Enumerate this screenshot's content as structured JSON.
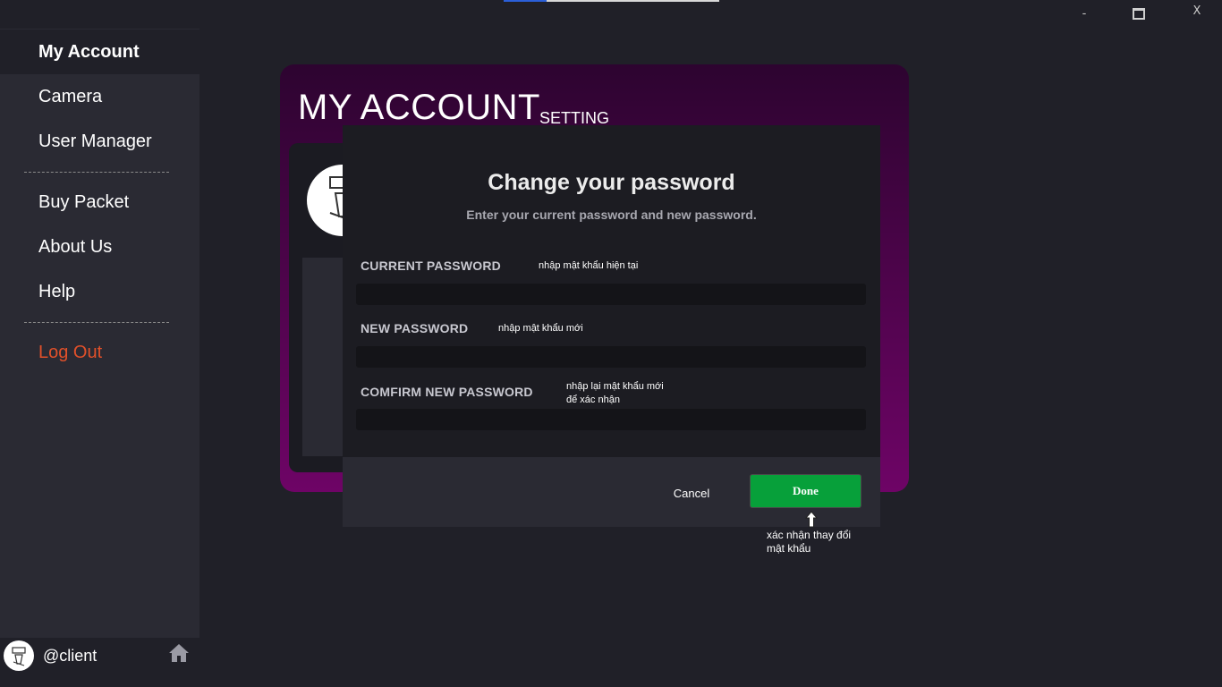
{
  "titlebar": {
    "minimize_glyph": "-",
    "close_glyph": "X",
    "progress": 0.2
  },
  "sidebar": {
    "items": [
      {
        "label": "My Account"
      },
      {
        "label": "Camera"
      },
      {
        "label": "User Manager"
      },
      {
        "label": "Buy Packet"
      },
      {
        "label": "About Us"
      },
      {
        "label": "Help"
      },
      {
        "label": "Log Out"
      }
    ],
    "user": {
      "name": "@client"
    }
  },
  "account": {
    "title": "MY ACCOUNT",
    "subtitle": "SETTING"
  },
  "dialog": {
    "title": "Change your password",
    "subtitle": "Enter your current password and new password.",
    "fields": [
      {
        "label": "CURRENT PASSWORD",
        "hint": "nhập mật khẩu hiện tại",
        "value": ""
      },
      {
        "label": "NEW PASSWORD",
        "hint": "nhập mật khẩu mới",
        "value": ""
      },
      {
        "label": "COMFIRM NEW PASSWORD",
        "hint_line1": "nhập lại mật khẩu mới",
        "hint_line2": "để xác nhận",
        "value": ""
      }
    ],
    "cancel_label": "Cancel",
    "done_label": "Done",
    "done_note_line1": "xác nhận thay đổi",
    "done_note_line2": "mật khẩu"
  },
  "colors": {
    "accent_purple": "#6e0466",
    "done_green": "#07a03a",
    "logout_orange": "#e0502a"
  },
  "icons": [
    "minimize-icon",
    "maximize-icon",
    "close-icon",
    "home-icon",
    "cursor-icon"
  ]
}
